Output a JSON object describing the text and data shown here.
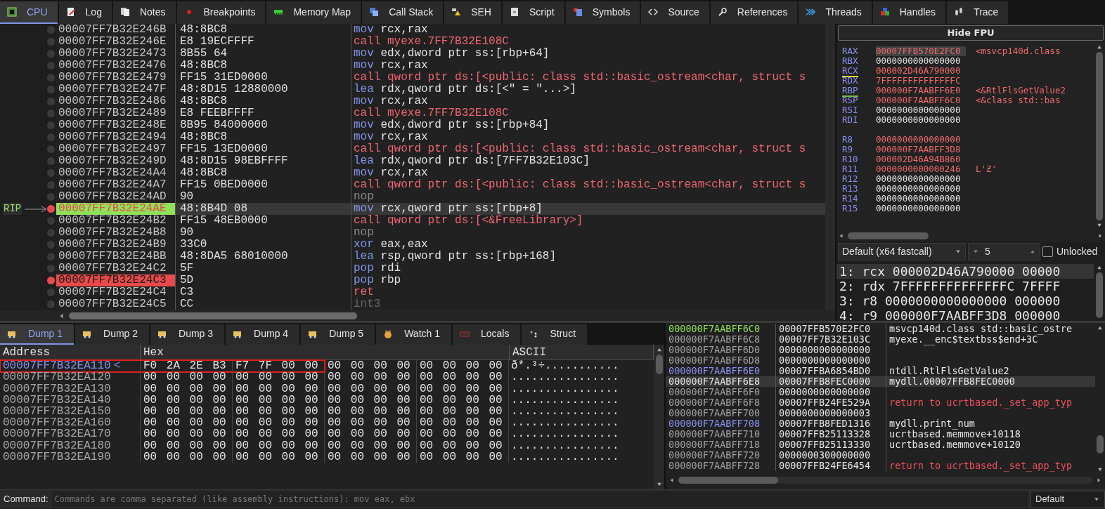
{
  "tabs": [
    {
      "label": "CPU",
      "selected": true
    },
    {
      "label": "Log",
      "selected": false
    },
    {
      "label": "Notes",
      "selected": false
    },
    {
      "label": "Breakpoints",
      "selected": false
    },
    {
      "label": "Memory Map",
      "selected": false
    },
    {
      "label": "Call Stack",
      "selected": false
    },
    {
      "label": "SEH",
      "selected": false
    },
    {
      "label": "Script",
      "selected": false
    },
    {
      "label": "Symbols",
      "selected": false
    },
    {
      "label": "Source",
      "selected": false
    },
    {
      "label": "References",
      "selected": false
    },
    {
      "label": "Threads",
      "selected": false
    },
    {
      "label": "Handles",
      "selected": false
    },
    {
      "label": "Trace",
      "selected": false
    }
  ],
  "disassembly": {
    "rip_label": "RIP",
    "rows": [
      {
        "address": "00007FF7B32E246B",
        "bytes": "48:8BC8",
        "mnemonic": "mov",
        "operands": "rcx,rax",
        "kind": "normal",
        "rip": false,
        "breakpoint": false,
        "selected": false
      },
      {
        "address": "00007FF7B32E246E",
        "bytes": "E8 19ECFFFF",
        "mnemonic": "call",
        "operands": "myexe.7FF7B32E108C",
        "kind": "call",
        "rip": false,
        "breakpoint": false,
        "selected": false
      },
      {
        "address": "00007FF7B32E2473",
        "bytes": "8B55 64",
        "mnemonic": "mov",
        "operands": "edx,dword ptr ss:[rbp+64]",
        "kind": "normal",
        "rip": false,
        "breakpoint": false,
        "selected": false
      },
      {
        "address": "00007FF7B32E2476",
        "bytes": "48:8BC8",
        "mnemonic": "mov",
        "operands": "rcx,rax",
        "kind": "normal",
        "rip": false,
        "breakpoint": false,
        "selected": false
      },
      {
        "address": "00007FF7B32E2479",
        "bytes": "FF15 31ED0000",
        "mnemonic": "call",
        "operands": "qword ptr ds:[<public: class std::basic_ostream<char, struct s",
        "kind": "call",
        "rip": false,
        "breakpoint": false,
        "selected": false
      },
      {
        "address": "00007FF7B32E247F",
        "bytes": "48:8D15 12880000",
        "mnemonic": "lea",
        "operands": "rdx,qword ptr ds:[<\" = \"...>]",
        "kind": "normal",
        "rip": false,
        "breakpoint": false,
        "selected": false
      },
      {
        "address": "00007FF7B32E2486",
        "bytes": "48:8BC8",
        "mnemonic": "mov",
        "operands": "rcx,rax",
        "kind": "normal",
        "rip": false,
        "breakpoint": false,
        "selected": false
      },
      {
        "address": "00007FF7B32E2489",
        "bytes": "E8 FEEBFFFF",
        "mnemonic": "call",
        "operands": "myexe.7FF7B32E108C",
        "kind": "call",
        "rip": false,
        "breakpoint": false,
        "selected": false
      },
      {
        "address": "00007FF7B32E248E",
        "bytes": "8B95 84000000",
        "mnemonic": "mov",
        "operands": "edx,dword ptr ss:[rbp+84]",
        "kind": "normal",
        "rip": false,
        "breakpoint": false,
        "selected": false
      },
      {
        "address": "00007FF7B32E2494",
        "bytes": "48:8BC8",
        "mnemonic": "mov",
        "operands": "rcx,rax",
        "kind": "normal",
        "rip": false,
        "breakpoint": false,
        "selected": false
      },
      {
        "address": "00007FF7B32E2497",
        "bytes": "FF15 13ED0000",
        "mnemonic": "call",
        "operands": "qword ptr ds:[<public: class std::basic_ostream<char, struct s",
        "kind": "call",
        "rip": false,
        "breakpoint": false,
        "selected": false
      },
      {
        "address": "00007FF7B32E249D",
        "bytes": "48:8D15 98EBFFFF",
        "mnemonic": "lea",
        "operands": "rdx,qword ptr ds:[7FF7B32E103C]",
        "kind": "normal",
        "rip": false,
        "breakpoint": false,
        "selected": false
      },
      {
        "address": "00007FF7B32E24A4",
        "bytes": "48:8BC8",
        "mnemonic": "mov",
        "operands": "rcx,rax",
        "kind": "normal",
        "rip": false,
        "breakpoint": false,
        "selected": false
      },
      {
        "address": "00007FF7B32E24A7",
        "bytes": "FF15 0BED0000",
        "mnemonic": "call",
        "operands": "qword ptr ds:[<public: class std::basic_ostream<char, struct s",
        "kind": "call",
        "rip": false,
        "breakpoint": false,
        "selected": false
      },
      {
        "address": "00007FF7B32E24AD",
        "bytes": "90",
        "mnemonic": "nop",
        "kind": "nop",
        "rip": false,
        "breakpoint": false,
        "selected": false
      },
      {
        "address": "00007FF7B32E24AE",
        "bytes": "48:8B4D 08",
        "mnemonic": "mov",
        "operands": "rcx,qword ptr ss:[rbp+8]",
        "kind": "normal",
        "rip": true,
        "breakpoint": true,
        "selected": true
      },
      {
        "address": "00007FF7B32E24B2",
        "bytes": "FF15 48EB0000",
        "mnemonic": "call",
        "operands": "qword ptr ds:[<&FreeLibrary>]",
        "kind": "call",
        "rip": false,
        "breakpoint": false,
        "selected": false
      },
      {
        "address": "00007FF7B32E24B8",
        "bytes": "90",
        "mnemonic": "nop",
        "kind": "nop",
        "rip": false,
        "breakpoint": false,
        "selected": false
      },
      {
        "address": "00007FF7B32E24B9",
        "bytes": "33C0",
        "mnemonic": "xor",
        "operands": "eax,eax",
        "kind": "normal",
        "rip": false,
        "breakpoint": false,
        "selected": false
      },
      {
        "address": "00007FF7B32E24BB",
        "bytes": "48:8DA5 68010000",
        "mnemonic": "lea",
        "operands": "rsp,qword ptr ss:[rbp+168]",
        "kind": "normal",
        "rip": false,
        "breakpoint": false,
        "selected": false
      },
      {
        "address": "00007FF7B32E24C2",
        "bytes": "5F",
        "mnemonic": "pop",
        "operands": "rdi",
        "kind": "normal",
        "rip": false,
        "breakpoint": false,
        "selected": false
      },
      {
        "address": "00007FF7B32E24C3",
        "bytes": "5D",
        "mnemonic": "pop",
        "operands": "rbp",
        "kind": "normal",
        "rip": false,
        "breakpoint": true,
        "selected": false
      },
      {
        "address": "00007FF7B32E24C4",
        "bytes": "C3",
        "mnemonic": "ret",
        "kind": "call",
        "rip": false,
        "breakpoint": false,
        "selected": false
      },
      {
        "address": "00007FF7B32E24C5",
        "bytes": "CC",
        "mnemonic": "int3",
        "kind": "padding",
        "rip": false,
        "breakpoint": false,
        "selected": false
      }
    ]
  },
  "registers": {
    "button": "Hide FPU",
    "groups": [
      [
        {
          "name": "RAX",
          "value": "00007FFB570E2FC0",
          "comment": "<msvcp140d.class",
          "changed": true,
          "selected": true
        },
        {
          "name": "RBX",
          "value": "0000000000000000",
          "changed": false,
          "selected": false
        },
        {
          "name": "RCX",
          "value": "000002D46A790000",
          "changed": true,
          "selected": false,
          "color": "#d8d840"
        },
        {
          "name": "RDX",
          "value": "7FFFFFFFFFFFFFFC",
          "changed": true,
          "selected": false
        },
        {
          "name": "RBP",
          "value": "000000F7AABFF6E0",
          "comment": "<&RtlFlsGetValue2",
          "changed": true,
          "selected": false,
          "color": "#70c040"
        },
        {
          "name": "RSP",
          "value": "000000F7AABFF6C0",
          "comment": "<&class std::bas",
          "changed": true,
          "selected": false
        },
        {
          "name": "RSI",
          "value": "0000000000000000",
          "changed": false,
          "selected": false
        },
        {
          "name": "RDI",
          "value": "0000000000000000",
          "changed": false,
          "selected": false
        }
      ],
      [
        {
          "name": "R8",
          "value": "0000000000000000",
          "changed": true,
          "selected": false
        },
        {
          "name": "R9",
          "value": "000000F7AABFF3D8",
          "changed": true,
          "selected": false
        },
        {
          "name": "R10",
          "value": "000002D46A94B860",
          "changed": true,
          "selected": false
        },
        {
          "name": "R11",
          "value": "0000000000000246",
          "comment": "L'Ƶ'",
          "changed": true,
          "selected": false
        },
        {
          "name": "R12",
          "value": "0000000000000000",
          "changed": false,
          "selected": false
        },
        {
          "name": "R13",
          "value": "0000000000000000",
          "changed": false,
          "selected": false
        },
        {
          "name": "R14",
          "value": "0000000000000000",
          "changed": false,
          "selected": false
        },
        {
          "name": "R15",
          "value": "0000000000000000",
          "changed": false,
          "selected": false
        }
      ]
    ]
  },
  "call_convention": {
    "value": "Default (x64 fastcall)",
    "count": "5",
    "unlocked": {
      "label": "Unlocked",
      "checked": false
    },
    "args": [
      {
        "text": "1: rcx 000002D46A790000 00000",
        "selected": true
      },
      {
        "text": "2: rdx 7FFFFFFFFFFFFFFC 7FFFF",
        "selected": false
      },
      {
        "text": "3: r8 0000000000000000 000000",
        "selected": false
      },
      {
        "text": "4: r9 000000F7AABFF3D8 000000",
        "selected": false
      }
    ]
  },
  "dump_tabs": [
    {
      "label": "Dump 1",
      "selected": true
    },
    {
      "label": "Dump 2",
      "selected": false
    },
    {
      "label": "Dump 3",
      "selected": false
    },
    {
      "label": "Dump 4",
      "selected": false
    },
    {
      "label": "Dump 5",
      "selected": false
    },
    {
      "label": "Watch 1",
      "selected": false
    },
    {
      "label": "Locals",
      "selected": false
    },
    {
      "label": "Struct",
      "selected": false
    }
  ],
  "dump": {
    "columns": [
      "Address",
      "Hex",
      "ASCII"
    ],
    "rows": [
      {
        "address": "00007FF7B32EA110",
        "label": "<",
        "hex": [
          "F0 2A 2E B3",
          "F7 7F 00 00",
          "00 00 00 00",
          "00 00 00 00"
        ],
        "ascii": "ð*.³÷...........",
        "selected": true,
        "outlined": true
      },
      {
        "address": "00007FF7B32EA120",
        "hex": [
          "00 00 00 00",
          "00 00 00 00",
          "00 00 00 00",
          "00 00 00 00"
        ],
        "ascii": "................",
        "selected": false,
        "outlined": false
      },
      {
        "address": "00007FF7B32EA130",
        "hex": [
          "00 00 00 00",
          "00 00 00 00",
          "00 00 00 00",
          "00 00 00 00"
        ],
        "ascii": "................",
        "selected": false,
        "outlined": false
      },
      {
        "address": "00007FF7B32EA140",
        "hex": [
          "00 00 00 00",
          "00 00 00 00",
          "00 00 00 00",
          "00 00 00 00"
        ],
        "ascii": "................",
        "selected": false,
        "outlined": false
      },
      {
        "address": "00007FF7B32EA150",
        "hex": [
          "00 00 00 00",
          "00 00 00 00",
          "00 00 00 00",
          "00 00 00 00"
        ],
        "ascii": "................",
        "selected": false,
        "outlined": false
      },
      {
        "address": "00007FF7B32EA160",
        "hex": [
          "00 00 00 00",
          "00 00 00 00",
          "00 00 00 00",
          "00 00 00 00"
        ],
        "ascii": "................",
        "selected": false,
        "outlined": false
      },
      {
        "address": "00007FF7B32EA170",
        "hex": [
          "00 00 00 00",
          "00 00 00 00",
          "00 00 00 00",
          "00 00 00 00"
        ],
        "ascii": "................",
        "selected": false,
        "outlined": false
      },
      {
        "address": "00007FF7B32EA180",
        "hex": [
          "00 00 00 00",
          "00 00 00 00",
          "00 00 00 00",
          "00 00 00 00"
        ],
        "ascii": "................",
        "selected": false,
        "outlined": false
      },
      {
        "address": "00007FF7B32EA190",
        "hex": [
          "00 00 00 00",
          "00 00 00 00",
          "00 00 00 00",
          "00 00 00 00"
        ],
        "ascii": "................",
        "selected": false,
        "outlined": false
      }
    ]
  },
  "stack": {
    "rows": [
      {
        "address": "000000F7AABFF6C0",
        "value": "00007FFB570E2FC0",
        "comment": "msvcp140d.class std::basic_ostre",
        "kind": "top",
        "is_return": false,
        "selected": false
      },
      {
        "address": "000000F7AABFF6C8",
        "value": "00007FF7B32E103C",
        "comment": "myexe.__enc$textbss$end+3C",
        "kind": "plain",
        "is_return": false,
        "selected": false
      },
      {
        "address": "000000F7AABFF6D0",
        "value": "0000000000000000",
        "kind": "plain",
        "selected": false
      },
      {
        "address": "000000F7AABFF6D8",
        "value": "0000000000000000",
        "kind": "plain",
        "selected": false
      },
      {
        "address": "000000F7AABFF6E0",
        "value": "00007FFBA6854BD0",
        "comment": "ntdll.RtlFlsGetValue2",
        "kind": "frame",
        "is_return": false,
        "selected": false
      },
      {
        "address": "000000F7AABFF6E8",
        "value": "00007FFB8FEC0000",
        "comment": "mydll.00007FFB8FEC0000",
        "kind": "plain",
        "is_return": false,
        "selected": true
      },
      {
        "address": "000000F7AABFF6F0",
        "value": "0000000000000000",
        "kind": "plain",
        "selected": false
      },
      {
        "address": "000000F7AABFF6F8",
        "value": "00007FFB24FE529A",
        "comment": "return to ucrtbased._set_app_typ",
        "kind": "plain",
        "is_return": true,
        "selected": false
      },
      {
        "address": "000000F7AABFF700",
        "value": "0000000000000003",
        "kind": "plain",
        "selected": false
      },
      {
        "address": "000000F7AABFF708",
        "value": "00007FFB8FED1316",
        "comment": "mydll.print_num",
        "kind": "frame",
        "is_return": false,
        "selected": false
      },
      {
        "address": "000000F7AABFF710",
        "value": "00007FFB25113328",
        "comment": "ucrtbased.memmove+10118",
        "kind": "plain",
        "is_return": false,
        "selected": false
      },
      {
        "address": "000000F7AABFF718",
        "value": "00007FFB25113330",
        "comment": "ucrtbased.memmove+10120",
        "kind": "plain",
        "is_return": false,
        "selected": false
      },
      {
        "address": "000000F7AABFF720",
        "value": "0000000300000000",
        "kind": "plain",
        "selected": false
      },
      {
        "address": "000000F7AABFF728",
        "value": "00007FFB24FE6454",
        "comment": "return to ucrtbased._set_app_typ",
        "kind": "plain",
        "is_return": true,
        "selected": false
      }
    ]
  },
  "command": {
    "label": "Command:",
    "placeholder": "Commands are comma separated (like assembly instructions): mov eax, ebx",
    "mode": "Default"
  }
}
